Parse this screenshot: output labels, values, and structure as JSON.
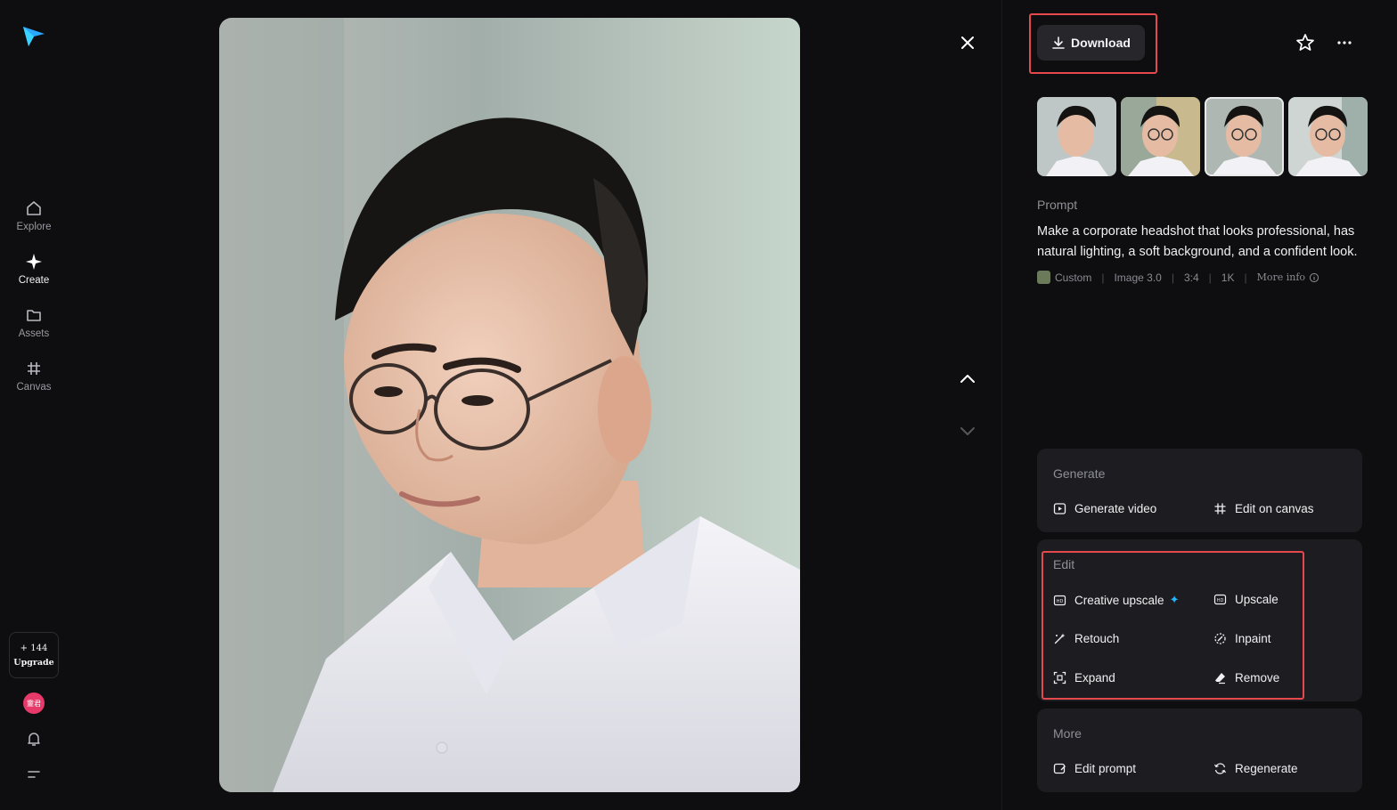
{
  "nav": {
    "items": [
      {
        "label": "Explore",
        "icon": "home-icon"
      },
      {
        "label": "Create",
        "icon": "sparkle-icon"
      },
      {
        "label": "Assets",
        "icon": "folder-icon"
      },
      {
        "label": "Canvas",
        "icon": "canvas-icon"
      }
    ],
    "credits": "+ 144",
    "upgrade_label": "Upgrade",
    "avatar_text": "靈君"
  },
  "header": {
    "download_label": "Download"
  },
  "prompt": {
    "label": "Prompt",
    "text": "Make a corporate headshot that looks professional, has natural lighting, a soft background, and a confident look.",
    "meta": {
      "style": "Custom",
      "model": "Image 3.0",
      "ratio": "3:4",
      "resolution": "1K",
      "more_info": "More info"
    }
  },
  "thumbnails": {
    "count": 4,
    "selected_index": 2
  },
  "generate": {
    "title": "Generate",
    "actions": [
      "Generate video",
      "Edit on canvas"
    ]
  },
  "edit": {
    "title": "Edit",
    "actions": [
      "Creative upscale",
      "Upscale",
      "Retouch",
      "Inpaint",
      "Expand",
      "Remove"
    ]
  },
  "more": {
    "title": "More",
    "actions": [
      "Edit prompt",
      "Regenerate"
    ]
  },
  "colors": {
    "background": "#0e0e10",
    "card": "#1d1d21",
    "highlight": "#e5484d",
    "accent": "#23b7ff",
    "avatar": "#e8396b"
  }
}
